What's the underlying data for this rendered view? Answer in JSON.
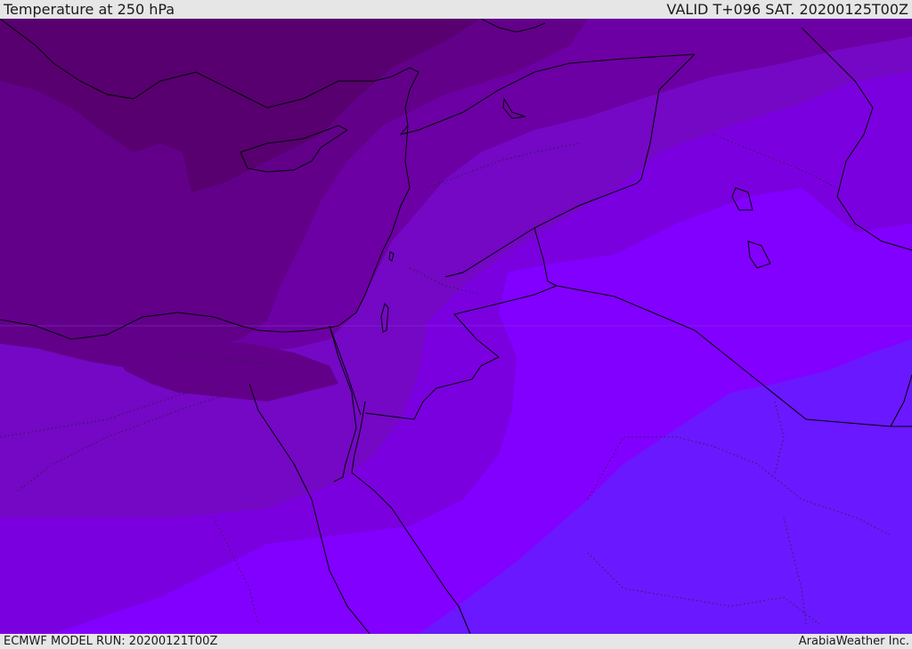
{
  "header": {
    "title": "Temperature at 250 hPa",
    "valid": "VALID T+096 SAT. 20200125T00Z"
  },
  "footer": {
    "model_run": "ECMWF MODEL RUN: 20200121T00Z",
    "credit": "ArabiaWeather Inc."
  },
  "map": {
    "region": "Eastern Mediterranean and Middle East",
    "fill_colors": {
      "darkest": "#58006f",
      "darker": "#62008a",
      "dark": "#6c00a4",
      "mid_dark": "#7408c4",
      "mid": "#7b00e0",
      "bright": "#8200ff",
      "bluish": "#6a18ff"
    }
  }
}
